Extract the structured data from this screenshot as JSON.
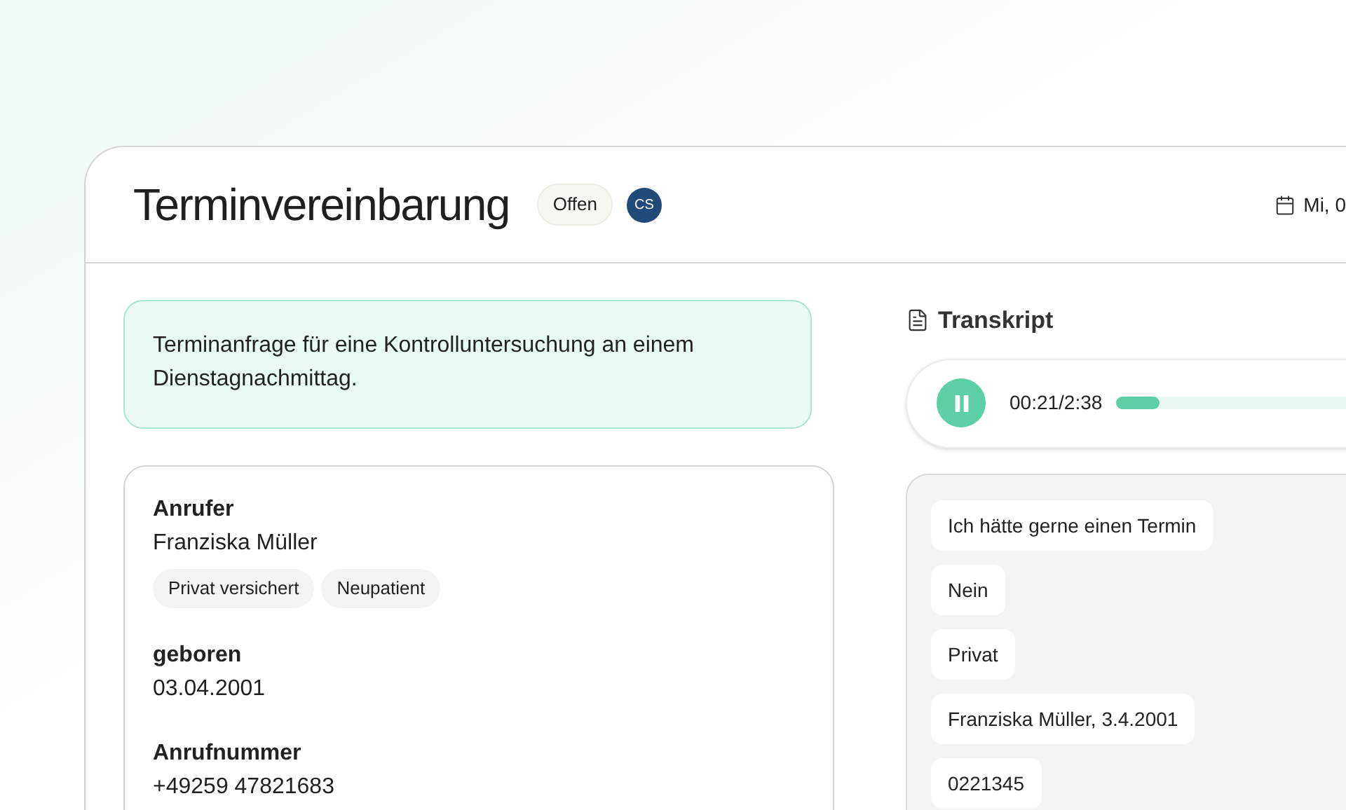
{
  "header": {
    "title": "Terminvereinbarung",
    "status": "Offen",
    "avatar": "CS",
    "date": "Mi, 0"
  },
  "summary": "Terminanfrage für eine Kontrolluntersuchung an einem Dienstagnachmittag.",
  "details": [
    {
      "label": "Anrufer",
      "value": "Franziska Müller",
      "tags": [
        "Privat versichert",
        "Neupatient"
      ]
    },
    {
      "label": "geboren",
      "value": "03.04.2001"
    },
    {
      "label": "Anrufnummer",
      "value": "+49259 47821683"
    }
  ],
  "transcript": {
    "title": "Transkript",
    "player": {
      "playing": true,
      "time": "00:21/2:38",
      "level": 0.13
    },
    "messages": [
      "Ich hätte gerne einen Termin",
      "Nein",
      "Privat",
      "Franziska Müller, 3.4.2001",
      "0221345"
    ]
  }
}
